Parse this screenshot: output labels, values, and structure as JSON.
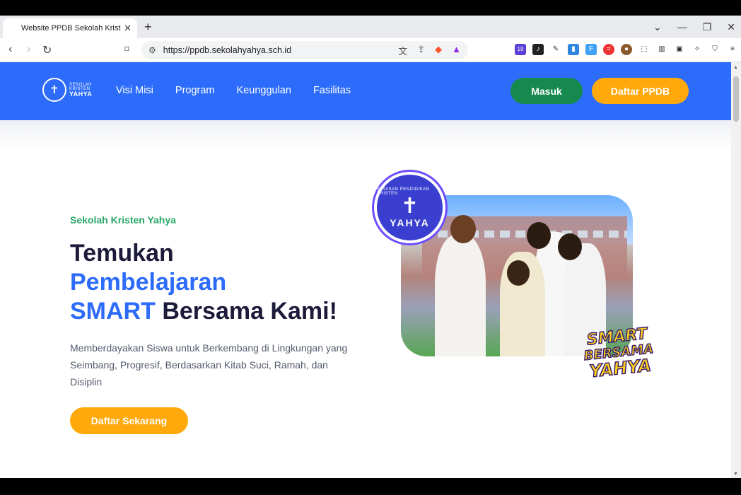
{
  "browser": {
    "tab_title": "Website PPDB Sekolah Kristen Yahya",
    "url": "https://ppdb.sekolahyahya.sch.id",
    "extension_badge": "19"
  },
  "site": {
    "logo": {
      "line1": "SEKOLAH",
      "line2": "KRISTEN",
      "line3": "YAHYA"
    },
    "nav": [
      "Visi Misi",
      "Program",
      "Keunggulan",
      "Fasilitas"
    ],
    "login_label": "Masuk",
    "register_label": "Daftar PPDB"
  },
  "hero": {
    "eyebrow": "Sekolah Kristen Yahya",
    "headline_line1": "Temukan",
    "headline_line2": "Pembelajaran",
    "headline_smart": "SMART",
    "headline_rest": " Bersama Kami!",
    "description": "Memberdayakan Siswa untuk Berkembang di Lingkungan yang Seimbang, Progresif, Berdasarkan Kitab Suci, Ramah, dan Disiplin",
    "cta_label": "Daftar Sekarang",
    "seal_top": "YAYASAN PENDIDIKAN KRISTEN",
    "seal_name": "YAHYA",
    "badge_lines": [
      "SMART",
      "BERSAMA",
      "YAHYA"
    ]
  },
  "colors": {
    "brand_blue": "#2d6cfa",
    "green": "#16894f",
    "orange": "#ffa90c"
  }
}
